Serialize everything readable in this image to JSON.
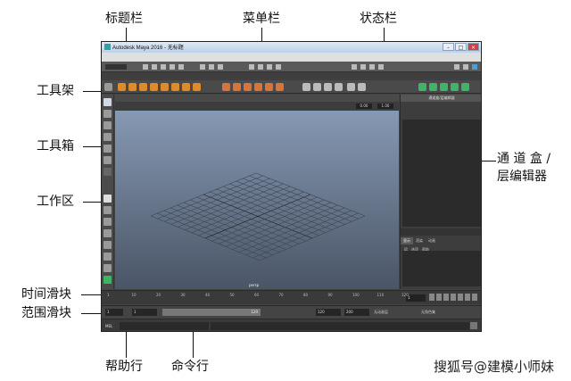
{
  "callouts": {
    "title_bar": "标题栏",
    "menu_bar": "菜单栏",
    "status_line": "状态栏",
    "shelf": "工具架",
    "toolbox": "工具箱",
    "workspace": "工作区",
    "channel_box_line1": "通 道 盒 /",
    "channel_box_line2": "层编辑器",
    "time_slider": "时间滑块",
    "range_slider": "范围滑块",
    "help_line": "帮助行",
    "command_line": "命令行"
  },
  "window": {
    "title": "Autodesk Maya 2016 - 无标题"
  },
  "menu": [
    "文件",
    "编辑",
    "创建",
    "选择",
    "修改",
    "显示",
    "窗口",
    "nParticle",
    "流体",
    "nCloth",
    "nHair",
    "nConstraint",
    "nCache",
    "字段/解算器",
    "效果",
    "Bifrost",
    "帮助"
  ],
  "shelf": {
    "tabs": [
      "曲线/曲面",
      "多边形",
      "雕刻",
      "绑定",
      "动画",
      "渲染",
      "FX",
      "FX缓存",
      "自定义",
      "XGen"
    ],
    "active_tab": "多边形"
  },
  "panel": {
    "menu": [
      "视图",
      "着色",
      "照明",
      "显示",
      "渲染器",
      "面板"
    ],
    "field_values": [
      "0.00",
      "1.00"
    ],
    "camera_label": "persp"
  },
  "channel_box": {
    "header": "通道盒/层编辑器",
    "menu": [
      "通道",
      "编辑",
      "对象",
      "显示"
    ],
    "layer_tabs": [
      "显示",
      "渲染",
      "动画"
    ],
    "active_layer_tab": "显示",
    "layer_menu": [
      "层",
      "选项",
      "帮助"
    ]
  },
  "time_slider": {
    "ticks": [
      "1",
      "10",
      "20",
      "30",
      "40",
      "50",
      "60",
      "70",
      "80",
      "90",
      "100",
      "110",
      "120"
    ],
    "current_frame": "1"
  },
  "range_slider": {
    "start": "1",
    "inner_start": "1",
    "range_end_label": "120",
    "end": "120",
    "max": "200",
    "anim_layer": "无动画层",
    "char_set": "无角色集"
  },
  "command_line": {
    "label": "MEL"
  },
  "watermark": "搜狐号@建模小师妹",
  "colors": {
    "viewport_top": "#8699b3",
    "viewport_bottom": "#4a5566",
    "ui_dark": "#444444"
  }
}
